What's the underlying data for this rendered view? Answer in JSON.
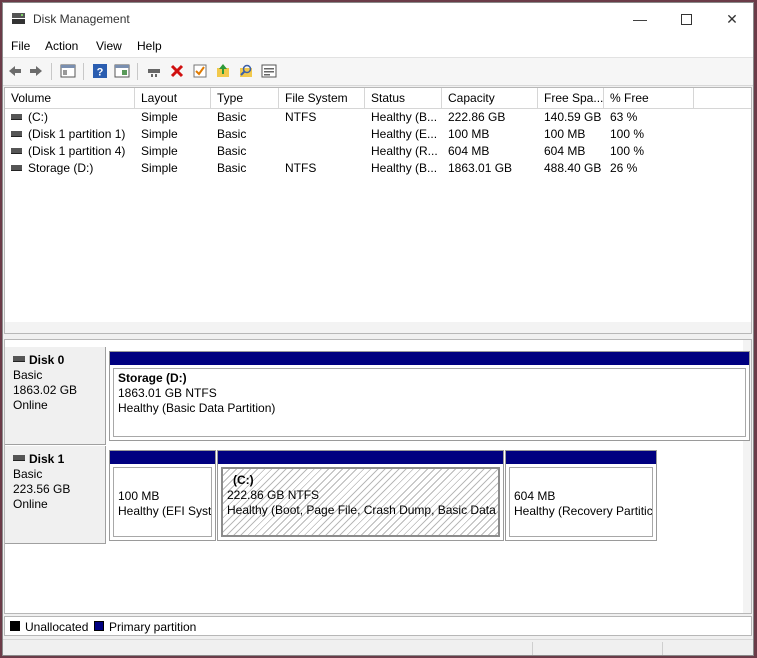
{
  "window": {
    "title": "Disk Management"
  },
  "menu": [
    "File",
    "Action",
    "View",
    "Help"
  ],
  "toolbar_icons": [
    "back-icon",
    "forward-icon",
    "show-hide-console-tree-icon",
    "help-icon",
    "properties-icon",
    "connect-icon",
    "delete-icon",
    "check-icon",
    "up-folder-icon",
    "search-icon",
    "view-icon"
  ],
  "columns": [
    "Volume",
    "Layout",
    "Type",
    "File System",
    "Status",
    "Capacity",
    "Free Spa...",
    "% Free"
  ],
  "volumes": [
    [
      "(C:)",
      "Simple",
      "Basic",
      "NTFS",
      "Healthy (B...",
      "222.86 GB",
      "140.59 GB",
      "63 %"
    ],
    [
      "(Disk 1 partition 1)",
      "Simple",
      "Basic",
      "",
      "Healthy (E...",
      "100 MB",
      "100 MB",
      "100 %"
    ],
    [
      "(Disk 1 partition 4)",
      "Simple",
      "Basic",
      "",
      "Healthy (R...",
      "604 MB",
      "604 MB",
      "100 %"
    ],
    [
      "Storage (D:)",
      "Simple",
      "Basic",
      "NTFS",
      "Healthy (B...",
      "1863.01 GB",
      "488.40 GB",
      "26 %"
    ]
  ],
  "disks": [
    {
      "name": "Disk 0",
      "type": "Basic",
      "size": "1863.02 GB",
      "status": "Online",
      "partitions": [
        {
          "title": "Storage  (D:)",
          "line1": "1863.01 GB NTFS",
          "line2": "Healthy (Basic Data Partition)"
        }
      ]
    },
    {
      "name": "Disk 1",
      "type": "Basic",
      "size": "223.56 GB",
      "status": "Online",
      "partitions": [
        {
          "title": "",
          "line1": "100 MB",
          "line2": "Healthy (EFI Syste"
        },
        {
          "title": "(C:)",
          "line1": "222.86 GB NTFS",
          "line2": "Healthy (Boot, Page File, Crash Dump, Basic Data Pa"
        },
        {
          "title": "",
          "line1": "604 MB",
          "line2": "Healthy (Recovery Partitic"
        }
      ]
    }
  ],
  "legend": [
    {
      "label": "Unallocated",
      "color": "#000000"
    },
    {
      "label": "Primary partition",
      "color": "#000080"
    }
  ],
  "colors": {
    "partition_bar": "#000080"
  }
}
